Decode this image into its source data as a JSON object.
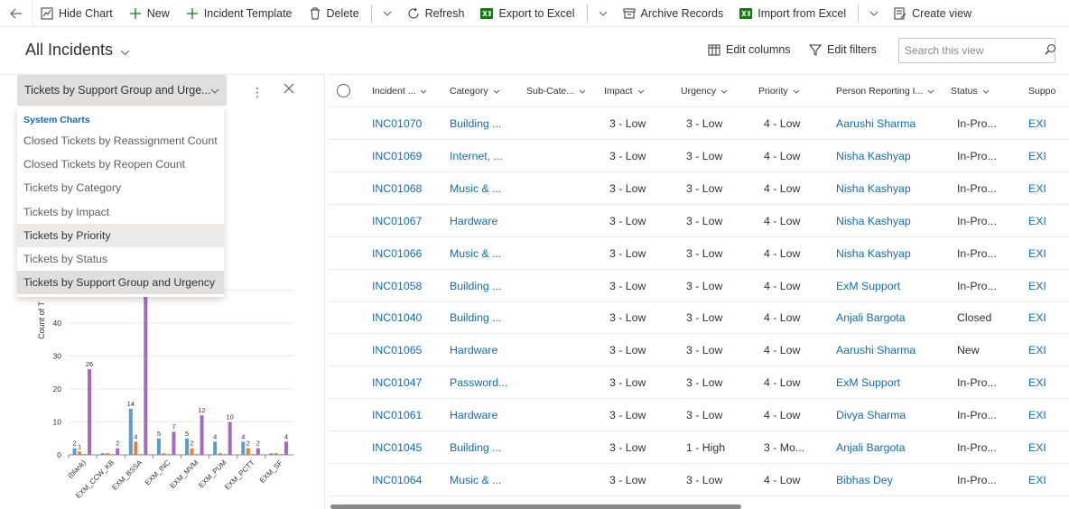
{
  "toolbar": {
    "hide_chart": "Hide Chart",
    "new": "New",
    "incident_template": "Incident Template",
    "delete": "Delete",
    "refresh": "Refresh",
    "export_excel": "Export to Excel",
    "archive_records": "Archive Records",
    "import_excel": "Import from Excel",
    "create_view": "Create view"
  },
  "view": {
    "title": "All Incidents",
    "edit_columns": "Edit columns",
    "edit_filters": "Edit filters",
    "search_placeholder": "Search this view"
  },
  "chart_panel": {
    "selected": "Tickets by Support Group and Urge...",
    "group_label": "System Charts",
    "options": [
      "Closed Tickets by Reassignment Count",
      "Closed Tickets by Reopen Count",
      "Tickets by Category",
      "Tickets by Impact",
      "Tickets by Priority",
      "Tickets by Status",
      "Tickets by Support Group and Urgency"
    ]
  },
  "chart_data": {
    "type": "bar",
    "ylabel": "Count of T",
    "ylim": [
      0,
      50
    ],
    "yticks": [
      0,
      10,
      20,
      30,
      40
    ],
    "categories": [
      "(blank)",
      "EXM_CCW_KB",
      "EXM_BSSA",
      "EXM_INC",
      "EXM_MVM",
      "EXM_PUM",
      "EXM_PCTT",
      "EXM_SF"
    ],
    "series": [
      {
        "color": "#5b9bd5",
        "values": [
          2,
          0.5,
          14,
          5,
          5,
          4,
          4,
          0.5
        ]
      },
      {
        "color": "#ed7d31",
        "values": [
          1,
          0.5,
          4,
          0.5,
          2,
          0.5,
          2,
          0.5
        ]
      },
      {
        "color": "#a5a5a5",
        "values": [
          0.3,
          0.3,
          0.3,
          0.3,
          0.3,
          0.3,
          0.3,
          0.3
        ]
      },
      {
        "color": "#a569bd",
        "values": [
          26,
          2,
          56,
          7,
          12,
          10,
          2,
          4
        ]
      }
    ],
    "labels": [
      {
        "cat": 0,
        "series": 0,
        "text": "2"
      },
      {
        "cat": 0,
        "series": 1,
        "text": "1"
      },
      {
        "cat": 0,
        "series": 3,
        "text": "26"
      },
      {
        "cat": 1,
        "series": 3,
        "text": "2"
      },
      {
        "cat": 2,
        "series": 0,
        "text": "14"
      },
      {
        "cat": 2,
        "series": 1,
        "text": "4"
      },
      {
        "cat": 3,
        "series": 0,
        "text": "5"
      },
      {
        "cat": 3,
        "series": 3,
        "text": "7"
      },
      {
        "cat": 4,
        "series": 0,
        "text": "5"
      },
      {
        "cat": 4,
        "series": 1,
        "text": "2"
      },
      {
        "cat": 4,
        "series": 3,
        "text": "12"
      },
      {
        "cat": 5,
        "series": 0,
        "text": "4"
      },
      {
        "cat": 5,
        "series": 3,
        "text": "10"
      },
      {
        "cat": 6,
        "series": 0,
        "text": "4"
      },
      {
        "cat": 6,
        "series": 1,
        "text": "2"
      },
      {
        "cat": 6,
        "series": 3,
        "text": "2"
      },
      {
        "cat": 7,
        "series": 3,
        "text": "4"
      }
    ]
  },
  "grid": {
    "columns": [
      "Incident ...",
      "Category",
      "Sub-Cate...",
      "Impact",
      "Urgency",
      "Priority",
      "Person Reporting I...",
      "Status",
      "Suppo"
    ],
    "rows": [
      [
        "INC01070",
        "Building ...",
        "",
        "3 - Low",
        "3 - Low",
        "4 - Low",
        "Aarushi Sharma",
        "In-Pro...",
        "EXI"
      ],
      [
        "INC01069",
        "Internet, ...",
        "",
        "3 - Low",
        "3 - Low",
        "4 - Low",
        "Nisha Kashyap",
        "In-Pro...",
        "EXI"
      ],
      [
        "INC01068",
        "Music & ...",
        "",
        "3 - Low",
        "3 - Low",
        "4 - Low",
        "Nisha Kashyap",
        "In-Pro...",
        "EXI"
      ],
      [
        "INC01067",
        "Hardware",
        "",
        "3 - Low",
        "3 - Low",
        "4 - Low",
        "Nisha Kashyap",
        "In-Pro...",
        "EXI"
      ],
      [
        "INC01066",
        "Music & ...",
        "",
        "3 - Low",
        "3 - Low",
        "4 - Low",
        "Nisha Kashyap",
        "In-Pro...",
        "EXI"
      ],
      [
        "INC01058",
        "Building ...",
        "",
        "3 - Low",
        "3 - Low",
        "4 - Low",
        "ExM Support",
        "In-Pro...",
        "EXI"
      ],
      [
        "INC01040",
        "Building ...",
        "",
        "3 - Low",
        "3 - Low",
        "4 - Low",
        "Anjali Bargota",
        "Closed",
        "EXI"
      ],
      [
        "INC01065",
        "Hardware",
        "",
        "3 - Low",
        "3 - Low",
        "4 - Low",
        "Aarushi Sharma",
        "New",
        "EXI"
      ],
      [
        "INC01047",
        "Password...",
        "",
        "3 - Low",
        "3 - Low",
        "4 - Low",
        "ExM Support",
        "In-Pro...",
        "EXI"
      ],
      [
        "INC01061",
        "Hardware",
        "",
        "3 - Low",
        "3 - Low",
        "4 - Low",
        "Divya Sharma",
        "In-Pro...",
        "EXI"
      ],
      [
        "INC01045",
        "Building ...",
        "",
        "3 - Low",
        "1 - High",
        "3 - Mo...",
        "Anjali Bargota",
        "In-Pro...",
        "EXI"
      ],
      [
        "INC01064",
        "Music & ...",
        "",
        "3 - Low",
        "3 - Low",
        "4 - Low",
        "Bibhas Dey",
        "In-Pro...",
        "EXI"
      ]
    ]
  }
}
